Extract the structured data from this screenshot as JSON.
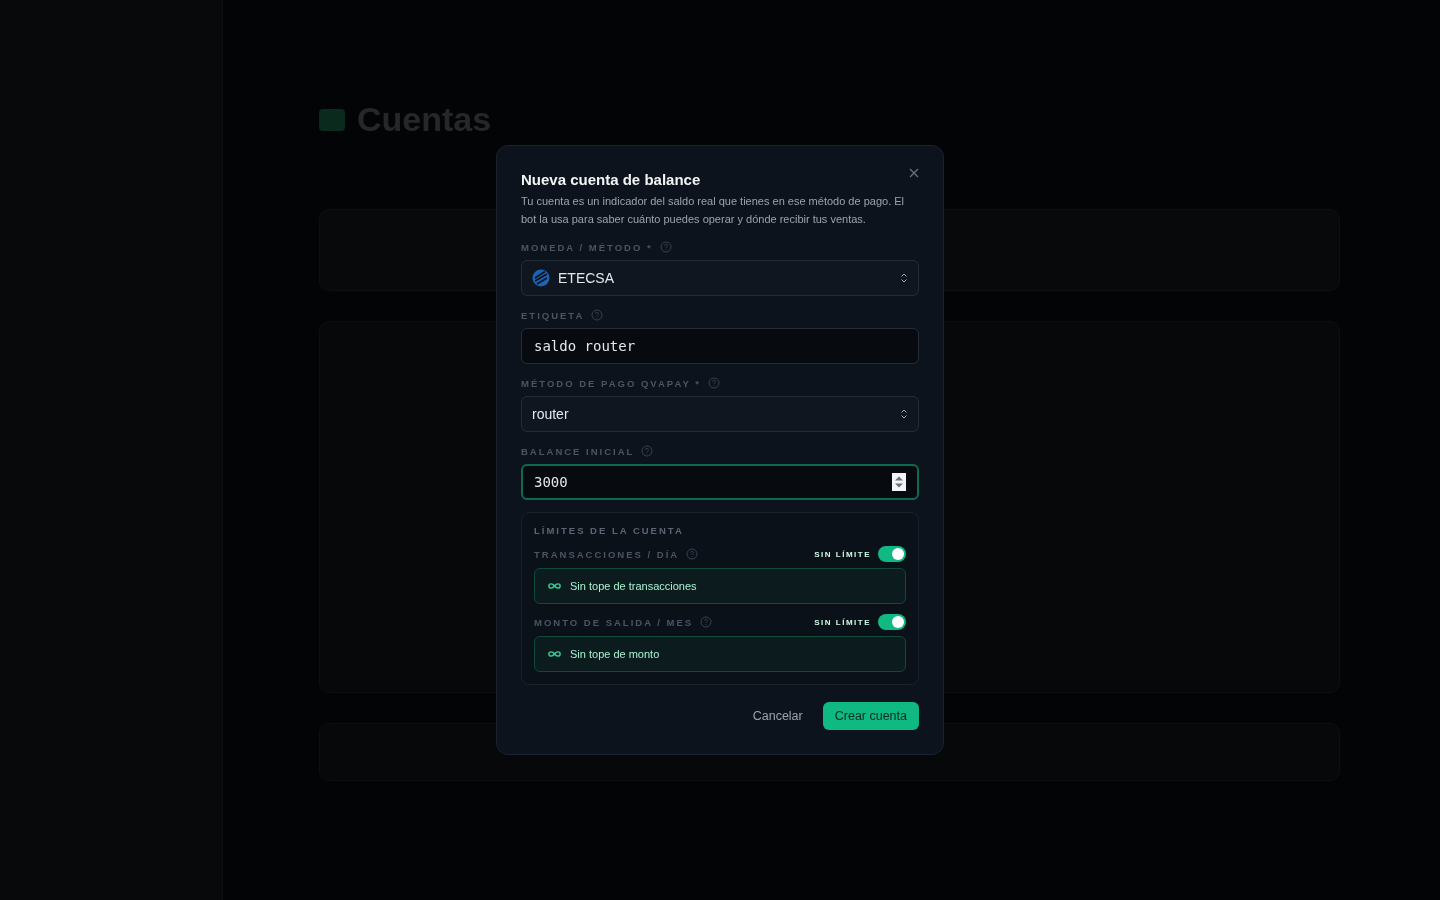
{
  "page": {
    "title": "Cuentas"
  },
  "dialog": {
    "title": "Nueva cuenta de balance",
    "description": "Tu cuenta es un indicador del saldo real que tienes en ese método de pago. El bot la usa para saber cuánto puedes operar y dónde recibir tus ventas.",
    "fields": [
      {
        "kind": "currency-select",
        "label": "MONEDA / MÉTODO *",
        "value": "ETECSA",
        "focused": false
      },
      {
        "kind": "text",
        "label": "ETIQUETA",
        "value": "saldo router",
        "focused": false
      },
      {
        "kind": "select",
        "label": "MÉTODO DE PAGO QVAPAY *",
        "value": "router",
        "focused": false
      },
      {
        "kind": "number",
        "label": "BALANCE INICIAL",
        "value": "3000",
        "focused": true
      }
    ],
    "limits": {
      "title": "LÍMITES DE LA CUENTA",
      "rows": [
        {
          "label": "TRANSACCIONES / DÍA",
          "toggle_label": "SIN LÍMITE",
          "on": true,
          "note": "Sin tope de transacciones"
        },
        {
          "label": "MONTO DE SALIDA / MES",
          "toggle_label": "SIN LÍMITE",
          "on": true,
          "note": "Sin tope de monto"
        }
      ]
    },
    "cancel": "Cancelar",
    "submit": "Crear cuenta"
  }
}
